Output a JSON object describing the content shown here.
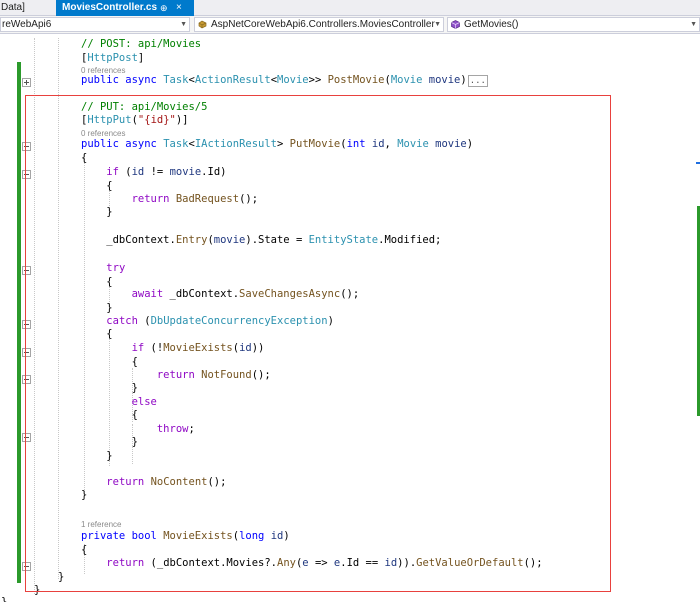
{
  "tabs": {
    "previous_label": "Data]",
    "active_label": "MoviesController.cs",
    "pin_glyph": "⊕",
    "close_glyph": "×"
  },
  "navbar": {
    "project": "reWebApi6",
    "class": "AspNetCoreWebApi6.Controllers.MoviesController",
    "member": "GetMovies()",
    "dropdown_arrow": "▼"
  },
  "colors": {
    "comment": "#008000",
    "keyword": "#0000ff",
    "control": "#8f08c4",
    "type": "#2b91af",
    "method": "#74531f",
    "string": "#a31515",
    "highlight_box": "#e8413e",
    "change_bar": "#2b9a2b",
    "tab_active": "#007acc"
  },
  "icons": {
    "class_icon": "class-icon",
    "method_icon": "method-icon",
    "fold_icon": "fold-toggle-icon"
  },
  "code": {
    "lines": [
      [
        {
          "k": "comment",
          "t": "// POST: api/Movies"
        }
      ],
      [
        {
          "k": "plain",
          "t": "["
        },
        {
          "k": "type",
          "t": "HttpPost"
        },
        {
          "k": "plain",
          "t": "]"
        }
      ],
      [
        {
          "k": "ref",
          "t": "0 references"
        }
      ],
      [
        {
          "k": "keyword",
          "t": "public "
        },
        {
          "k": "keyword",
          "t": "async "
        },
        {
          "k": "type",
          "t": "Task"
        },
        {
          "k": "plain",
          "t": "<"
        },
        {
          "k": "type",
          "t": "ActionResult"
        },
        {
          "k": "plain",
          "t": "<"
        },
        {
          "k": "type",
          "t": "Movie"
        },
        {
          "k": "plain",
          "t": ">> "
        },
        {
          "k": "method",
          "t": "PostMovie"
        },
        {
          "k": "plain",
          "t": "("
        },
        {
          "k": "type",
          "t": "Movie"
        },
        {
          "k": "plain",
          "t": " "
        },
        {
          "k": "param",
          "t": "movie"
        },
        {
          "k": "plain",
          "t": ")"
        },
        {
          "k": "collapsed",
          "t": "..."
        }
      ],
      [],
      [
        {
          "k": "comment",
          "t": "// PUT: api/Movies/5"
        }
      ],
      [
        {
          "k": "plain",
          "t": "["
        },
        {
          "k": "type",
          "t": "HttpPut"
        },
        {
          "k": "plain",
          "t": "("
        },
        {
          "k": "string",
          "t": "\"{id}\""
        },
        {
          "k": "plain",
          "t": ")]"
        }
      ],
      [
        {
          "k": "ref",
          "t": "0 references"
        }
      ],
      [
        {
          "k": "keyword",
          "t": "public "
        },
        {
          "k": "keyword",
          "t": "async "
        },
        {
          "k": "type",
          "t": "Task"
        },
        {
          "k": "plain",
          "t": "<"
        },
        {
          "k": "type",
          "t": "IActionResult"
        },
        {
          "k": "plain",
          "t": "> "
        },
        {
          "k": "method",
          "t": "PutMovie"
        },
        {
          "k": "plain",
          "t": "("
        },
        {
          "k": "keyword",
          "t": "int"
        },
        {
          "k": "plain",
          "t": " "
        },
        {
          "k": "param",
          "t": "id"
        },
        {
          "k": "plain",
          "t": ", "
        },
        {
          "k": "type",
          "t": "Movie"
        },
        {
          "k": "plain",
          "t": " "
        },
        {
          "k": "param",
          "t": "movie"
        },
        {
          "k": "plain",
          "t": ")"
        }
      ],
      [
        {
          "k": "plain",
          "t": "{"
        }
      ],
      [
        {
          "k": "plain",
          "t": "    "
        },
        {
          "k": "control",
          "t": "if"
        },
        {
          "k": "plain",
          "t": " ("
        },
        {
          "k": "param",
          "t": "id"
        },
        {
          "k": "plain",
          "t": " != "
        },
        {
          "k": "param",
          "t": "movie"
        },
        {
          "k": "plain",
          "t": ".Id)"
        }
      ],
      [
        {
          "k": "plain",
          "t": "    {"
        }
      ],
      [
        {
          "k": "plain",
          "t": "        "
        },
        {
          "k": "control",
          "t": "return"
        },
        {
          "k": "plain",
          "t": " "
        },
        {
          "k": "method",
          "t": "BadRequest"
        },
        {
          "k": "plain",
          "t": "();"
        }
      ],
      [
        {
          "k": "plain",
          "t": "    }"
        }
      ],
      [],
      [
        {
          "k": "plain",
          "t": "    _dbContext."
        },
        {
          "k": "method",
          "t": "Entry"
        },
        {
          "k": "plain",
          "t": "("
        },
        {
          "k": "param",
          "t": "movie"
        },
        {
          "k": "plain",
          "t": ").State = "
        },
        {
          "k": "type",
          "t": "EntityState"
        },
        {
          "k": "plain",
          "t": ".Modified;"
        }
      ],
      [],
      [
        {
          "k": "plain",
          "t": "    "
        },
        {
          "k": "control",
          "t": "try"
        }
      ],
      [
        {
          "k": "plain",
          "t": "    {"
        }
      ],
      [
        {
          "k": "plain",
          "t": "        "
        },
        {
          "k": "control",
          "t": "await"
        },
        {
          "k": "plain",
          "t": " _dbContext."
        },
        {
          "k": "method",
          "t": "SaveChangesAsync"
        },
        {
          "k": "plain",
          "t": "();"
        }
      ],
      [
        {
          "k": "plain",
          "t": "    }"
        }
      ],
      [
        {
          "k": "plain",
          "t": "    "
        },
        {
          "k": "control",
          "t": "catch"
        },
        {
          "k": "plain",
          "t": " ("
        },
        {
          "k": "type",
          "t": "DbUpdateConcurrencyException"
        },
        {
          "k": "plain",
          "t": ")"
        }
      ],
      [
        {
          "k": "plain",
          "t": "    {"
        }
      ],
      [
        {
          "k": "plain",
          "t": "        "
        },
        {
          "k": "control",
          "t": "if"
        },
        {
          "k": "plain",
          "t": " (!"
        },
        {
          "k": "method",
          "t": "MovieExists"
        },
        {
          "k": "plain",
          "t": "("
        },
        {
          "k": "param",
          "t": "id"
        },
        {
          "k": "plain",
          "t": "))"
        }
      ],
      [
        {
          "k": "plain",
          "t": "        {"
        }
      ],
      [
        {
          "k": "plain",
          "t": "            "
        },
        {
          "k": "control",
          "t": "return"
        },
        {
          "k": "plain",
          "t": " "
        },
        {
          "k": "method",
          "t": "NotFound"
        },
        {
          "k": "plain",
          "t": "();"
        }
      ],
      [
        {
          "k": "plain",
          "t": "        }"
        }
      ],
      [
        {
          "k": "plain",
          "t": "        "
        },
        {
          "k": "control",
          "t": "else"
        }
      ],
      [
        {
          "k": "plain",
          "t": "        {"
        }
      ],
      [
        {
          "k": "plain",
          "t": "            "
        },
        {
          "k": "control",
          "t": "throw"
        },
        {
          "k": "plain",
          "t": ";"
        }
      ],
      [
        {
          "k": "plain",
          "t": "        }"
        }
      ],
      [
        {
          "k": "plain",
          "t": "    }"
        }
      ],
      [],
      [
        {
          "k": "plain",
          "t": "    "
        },
        {
          "k": "control",
          "t": "return"
        },
        {
          "k": "plain",
          "t": " "
        },
        {
          "k": "method",
          "t": "NoContent"
        },
        {
          "k": "plain",
          "t": "();"
        }
      ],
      [
        {
          "k": "plain",
          "t": "}"
        }
      ],
      [],
      [
        {
          "k": "ref",
          "t": "1 reference"
        }
      ],
      [
        {
          "k": "keyword",
          "t": "private "
        },
        {
          "k": "keyword",
          "t": "bool "
        },
        {
          "k": "method",
          "t": "MovieExists"
        },
        {
          "k": "plain",
          "t": "("
        },
        {
          "k": "keyword",
          "t": "long"
        },
        {
          "k": "plain",
          "t": " "
        },
        {
          "k": "param",
          "t": "id"
        },
        {
          "k": "plain",
          "t": ")"
        }
      ],
      [
        {
          "k": "plain",
          "t": "{"
        }
      ],
      [
        {
          "k": "plain",
          "t": "    "
        },
        {
          "k": "control",
          "t": "return"
        },
        {
          "k": "plain",
          "t": " (_dbContext.Movies?."
        },
        {
          "k": "method",
          "t": "Any"
        },
        {
          "k": "plain",
          "t": "("
        },
        {
          "k": "param",
          "t": "e"
        },
        {
          "k": "plain",
          "t": " => "
        },
        {
          "k": "param",
          "t": "e"
        },
        {
          "k": "plain",
          "t": ".Id == "
        },
        {
          "k": "param",
          "t": "id"
        },
        {
          "k": "plain",
          "t": "))."
        },
        {
          "k": "method",
          "t": "GetValueOrDefault"
        },
        {
          "k": "plain",
          "t": "();"
        }
      ],
      [
        {
          "k": "plain",
          "t": "}"
        }
      ],
      [
        {
          "k": "plain",
          "t": "}"
        }
      ],
      [
        {
          "k": "plain",
          "t": "}"
        }
      ]
    ]
  }
}
